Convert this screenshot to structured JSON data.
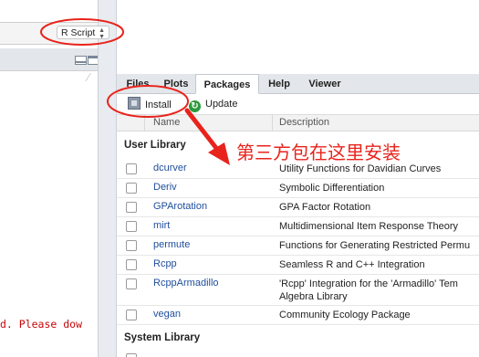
{
  "editor": {
    "script_type": "R Script"
  },
  "console": {
    "message": "d. Please dow"
  },
  "tabs": [
    {
      "label": "Files",
      "active": false
    },
    {
      "label": "Plots",
      "active": false
    },
    {
      "label": "Packages",
      "active": true
    },
    {
      "label": "Help",
      "active": false
    },
    {
      "label": "Viewer",
      "active": false
    }
  ],
  "toolbar": {
    "install_label": "Install",
    "install_icon": "install-icon",
    "update_label": "Update",
    "update_icon": "update-icon"
  },
  "columns": {
    "name": "Name",
    "description": "Description"
  },
  "user_library": {
    "title": "User Library",
    "packages": [
      {
        "name": "dcurver",
        "description": "Utility Functions for Davidian Curves"
      },
      {
        "name": "Deriv",
        "description": "Symbolic Differentiation"
      },
      {
        "name": "GPArotation",
        "description": "GPA Factor Rotation"
      },
      {
        "name": "mirt",
        "description": "Multidimensional Item Response Theory"
      },
      {
        "name": "permute",
        "description": "Functions for Generating Restricted Permu"
      },
      {
        "name": "Rcpp",
        "description": "Seamless R and C++ Integration"
      },
      {
        "name": "RcppArmadillo",
        "description": "'Rcpp' Integration for the 'Armadillo' Tem",
        "description_line2": "Algebra Library"
      },
      {
        "name": "vegan",
        "description": "Community Ecology Package"
      }
    ]
  },
  "system_library": {
    "title": "System Library"
  },
  "annotation": {
    "text": "第三方包在这里安装",
    "color": "#e8231c"
  },
  "colors": {
    "link": "#1f4e9c",
    "console_error": "#c5060b",
    "annotation_red": "#e8231c"
  }
}
